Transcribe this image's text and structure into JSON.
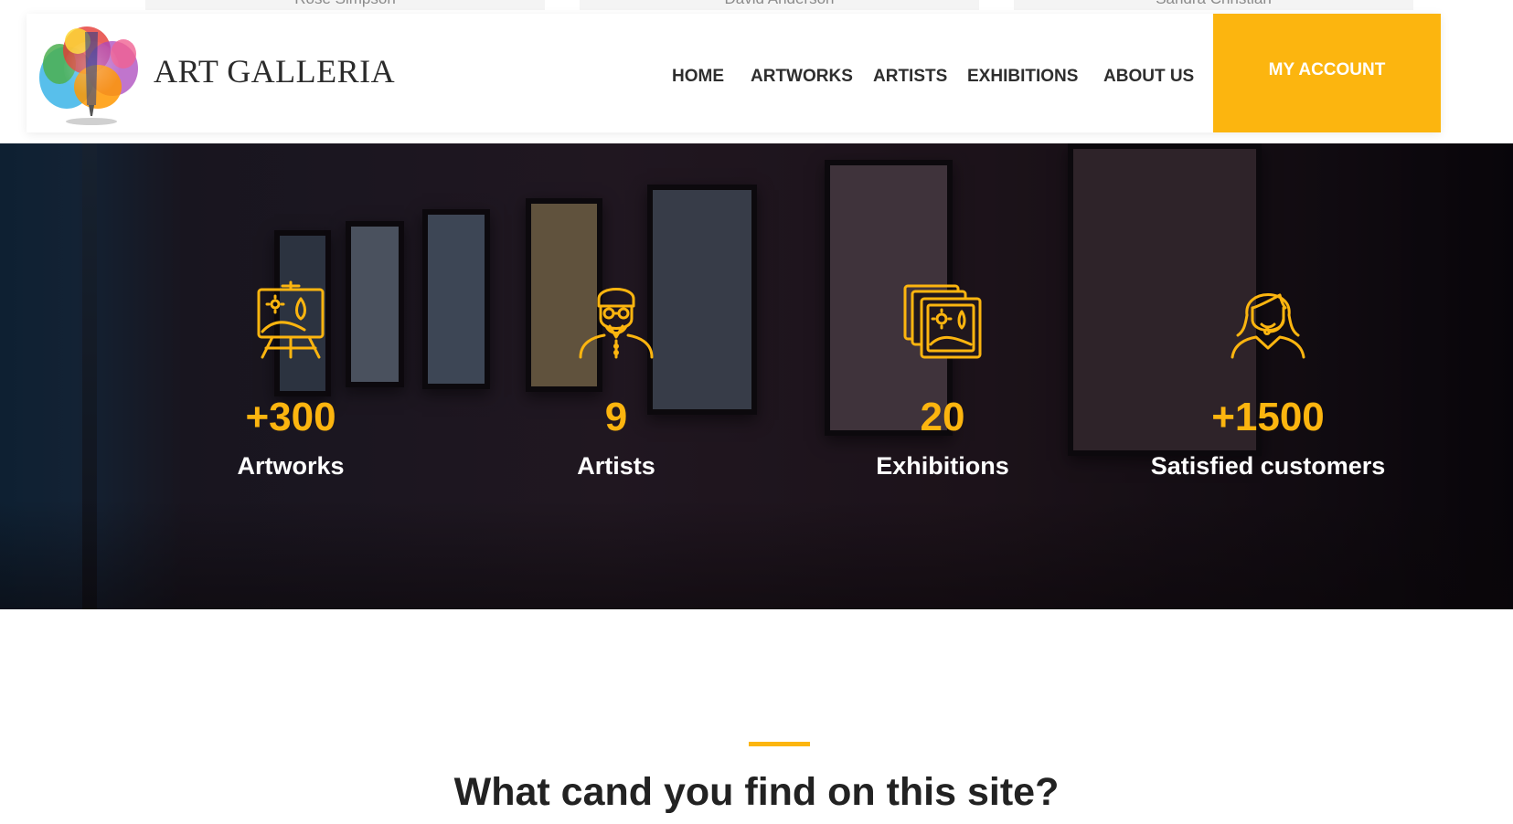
{
  "previous_section": {
    "team_names": [
      "Rose Simpson",
      "David Anderson",
      "Sandra Christian"
    ]
  },
  "header": {
    "brand": "ART GALLERIA",
    "nav": [
      "HOME",
      "ARTWORKS",
      "ARTISTS",
      "EXHIBITIONS",
      "ABOUT US"
    ],
    "account_button": "MY ACCOUNT"
  },
  "stats": [
    {
      "icon": "easel-painting-icon",
      "value": "+300",
      "label": "Artworks"
    },
    {
      "icon": "artist-avatar-icon",
      "value": "9",
      "label": "Artists"
    },
    {
      "icon": "picture-gallery-icon",
      "value": "20",
      "label": "Exhibitions"
    },
    {
      "icon": "customer-support-icon",
      "value": "+1500",
      "label": "Satisfied customers"
    }
  ],
  "section": {
    "title": "What cand you find on this site?"
  },
  "colors": {
    "accent": "#fcb50f",
    "text_dark": "#2e2e2e",
    "white": "#ffffff"
  }
}
